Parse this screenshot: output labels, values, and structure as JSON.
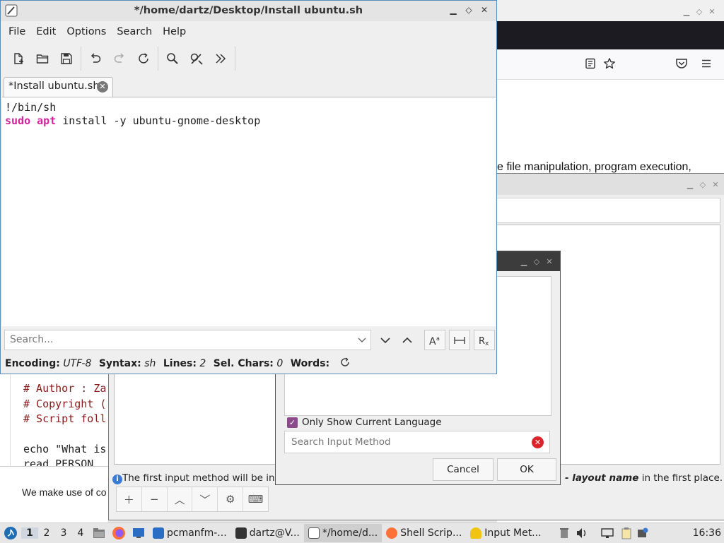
{
  "editor": {
    "title": "*/home/dartz/Desktop/Install ubuntu.sh",
    "menu": [
      "File",
      "Edit",
      "Options",
      "Search",
      "Help"
    ],
    "tab_label": "*Install ubuntu.sh",
    "code": {
      "line1": "!/bin/sh",
      "line2_kw1": "sudo",
      "line2_kw2": "apt",
      "line2_rest": " install -y ubuntu-gnome-desktop"
    },
    "search_placeholder": "Search...",
    "status": {
      "encoding_label": "Encoding:",
      "encoding_value": "UTF-8",
      "syntax_label": "Syntax:",
      "syntax_value": "sh",
      "lines_label": "Lines:",
      "lines_value": "2",
      "selchars_label": "Sel. Chars:",
      "selchars_value": "0",
      "words_label": "Words:"
    },
    "accent_color": "#d6209d"
  },
  "browser": {
    "text": "e file manipulation, program execution,"
  },
  "input_method_config": {
    "info_text_start": "The first input method will be ina",
    "info_text_end_bold": " - layout name",
    "info_text_end": " in the first place."
  },
  "add_input_method": {
    "checkbox_label": "Only Show Current Language",
    "search_placeholder": "Search Input Method",
    "cancel_label": "Cancel",
    "ok_label": "OK"
  },
  "terminal": {
    "lines": [
      "# Author : Za",
      "# Copyright (",
      "# Script foll",
      "",
      "echo \"What is",
      "read PERSON"
    ]
  },
  "cookie_text": "We make use of co",
  "taskbar": {
    "workspaces": [
      "1",
      "2",
      "3",
      "4"
    ],
    "tasks": [
      "pcmanfm-...",
      "dartz@V...",
      "*/home/d...",
      "Shell Scrip...",
      "Input Met..."
    ],
    "clock": "16:36"
  }
}
